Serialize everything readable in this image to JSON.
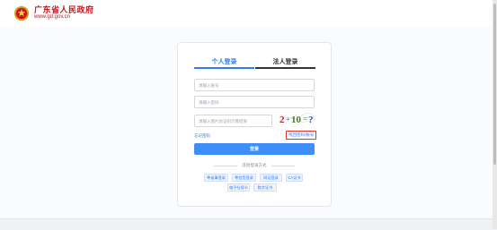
{
  "header": {
    "site_name": "广东省人民政府",
    "site_url": "www.gd.gov.cn"
  },
  "login": {
    "tabs": [
      {
        "label": "个人登录",
        "active": true
      },
      {
        "label": "法人登录",
        "active": false
      }
    ],
    "username_placeholder": "请输入账号",
    "password_placeholder": "请输入密码",
    "captcha_placeholder": "请输入图片验证码计算结果",
    "captcha_text": "2+10=?",
    "forgot_label": "忘记密码",
    "retrieve_label": "找回密码/账号",
    "login_button": "登录",
    "other_methods_title": "其他登录方式",
    "other_methods": [
      "粤省事登录",
      "粤信签登录",
      "网证登录",
      "CA证书",
      "电子社保卡",
      "数字证书"
    ]
  },
  "colors": {
    "brand_red": "#c8161d",
    "accent_blue": "#2f7cf6",
    "button_blue": "#3d8ef8",
    "highlight_border": "#d9342b"
  }
}
